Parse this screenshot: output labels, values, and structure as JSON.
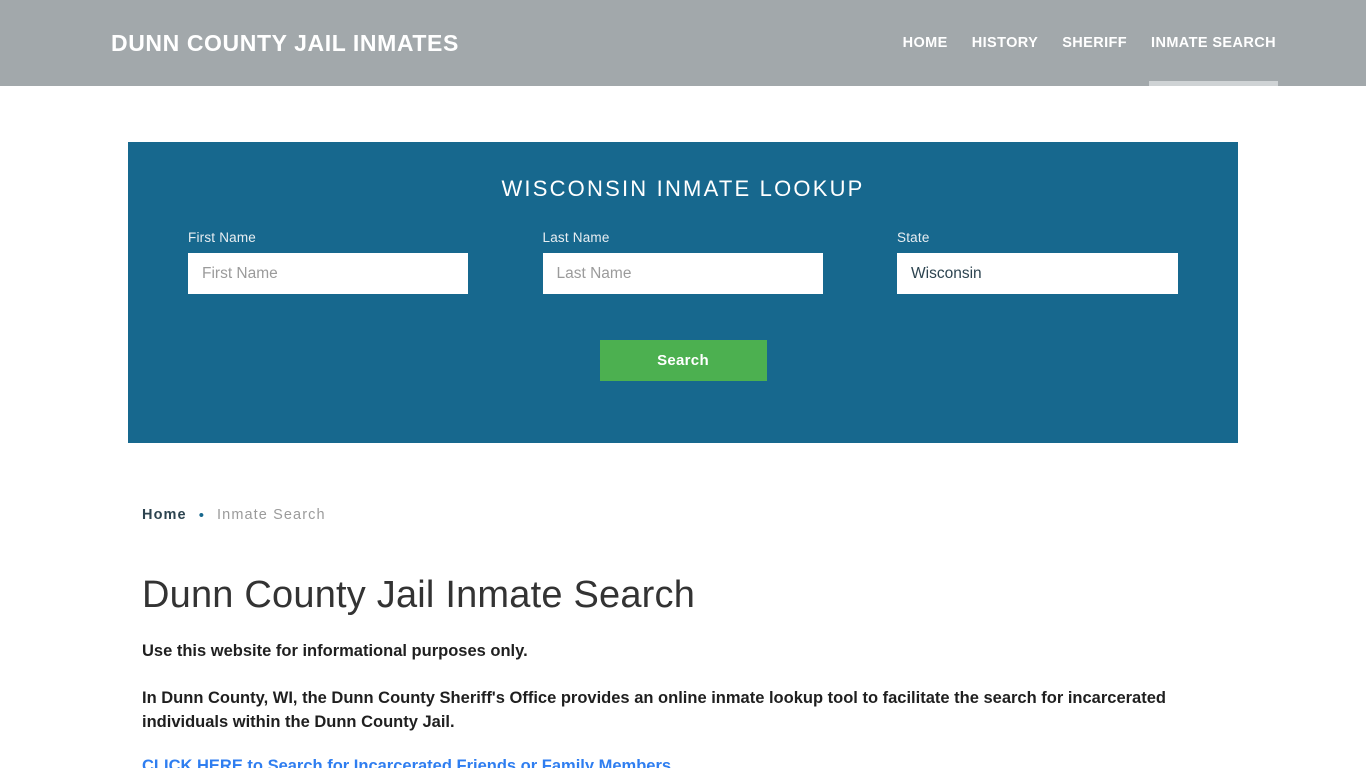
{
  "header": {
    "site_title": "DUNN COUNTY JAIL INMATES",
    "background_color": "#a2a8ab",
    "nav": [
      {
        "label": "HOME",
        "active": false
      },
      {
        "label": "HISTORY",
        "active": false
      },
      {
        "label": "SHERIFF",
        "active": false
      },
      {
        "label": "INMATE SEARCH",
        "active": true
      }
    ]
  },
  "search_panel": {
    "title": "WISCONSIN INMATE LOOKUP",
    "background_color": "#17688e",
    "fields": {
      "first_name": {
        "label": "First Name",
        "value": "",
        "placeholder": "First Name"
      },
      "last_name": {
        "label": "Last Name",
        "value": "",
        "placeholder": "Last Name"
      },
      "state": {
        "label": "State",
        "value": "Wisconsin",
        "options": [
          "Wisconsin"
        ]
      }
    },
    "submit": {
      "label": "Search",
      "color": "#4cb050"
    }
  },
  "breadcrumb": {
    "home": "Home",
    "separator": "•",
    "current": "Inmate Search"
  },
  "main": {
    "page_title": "Dunn County Jail Inmate Search",
    "paragraph_1": "Use this website for informational purposes only.",
    "paragraph_2": "In Dunn County, WI, the Dunn County Sheriff's Office provides an online inmate lookup tool to facilitate the search for incarcerated individuals within the Dunn County Jail.",
    "link_text": "CLICK HERE to Search for Incarcerated Friends or Family Members",
    "link_color": "#2f7ef0"
  }
}
